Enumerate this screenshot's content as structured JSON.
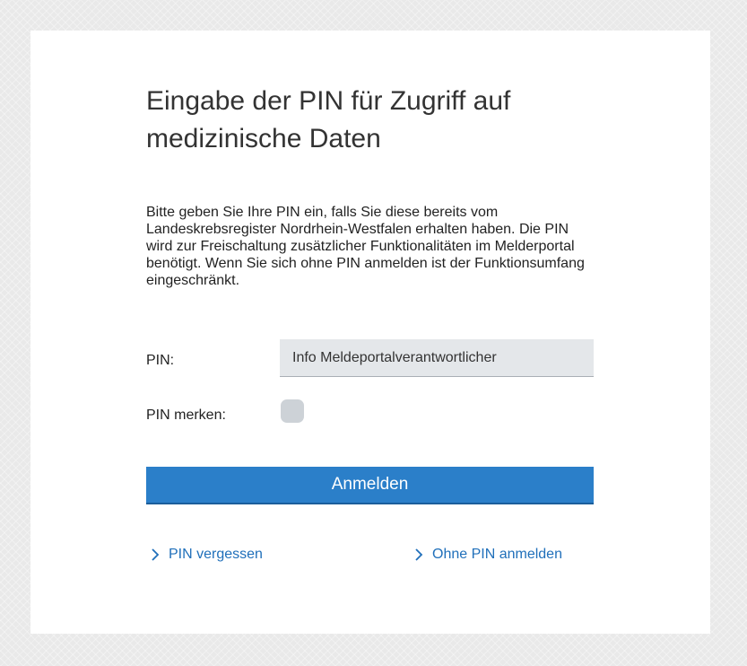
{
  "dialog": {
    "title": "Eingabe der PIN für Zugriff auf medizinische Daten",
    "description": "Bitte geben Sie Ihre PIN ein, falls Sie diese bereits vom Landeskrebsregister Nordrhein-Westfalen erhalten haben. Die PIN wird zur Freischaltung zusätzlicher Funktionalitäten im Melderportal benötigt. Wenn Sie sich ohne PIN anmelden ist der Funktionsumfang eingeschränkt.",
    "pin_label": "PIN:",
    "pin_value": "Info Meldeportalverantwortlicher",
    "remember_label": "PIN merken:",
    "remember_checked": false,
    "login_button": "Anmelden",
    "links": {
      "forgot_pin": "PIN vergessen",
      "login_without_pin": "Ohne PIN anmelden"
    }
  },
  "colors": {
    "accent": "#2b7fc9",
    "link": "#1f6fba",
    "input_bg": "#e4e7ea",
    "checkbox_bg": "#cdd2d7"
  },
  "icons": {
    "link_icon": "chevron-right-icon"
  }
}
